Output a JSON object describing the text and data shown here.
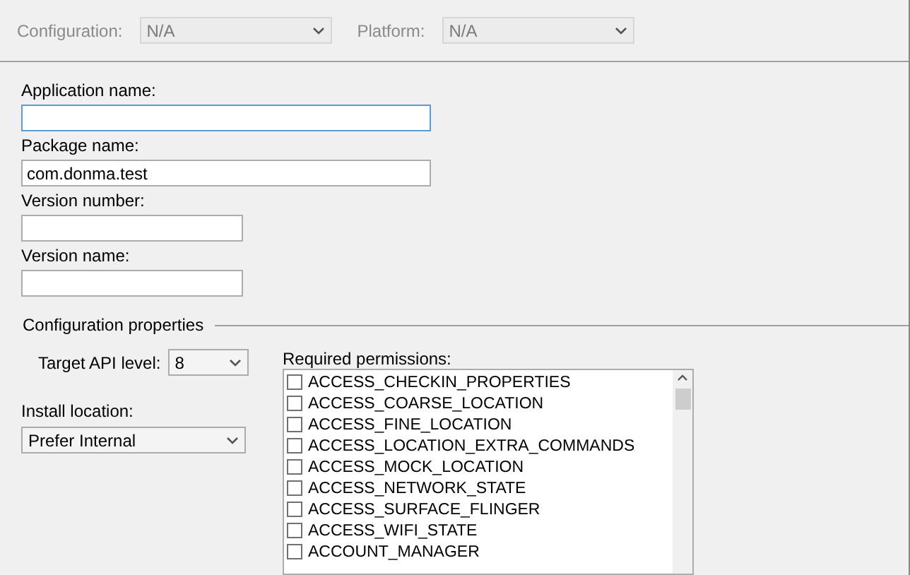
{
  "toolbar": {
    "configuration": {
      "label": "Configuration:",
      "value": "N/A",
      "disabled": true
    },
    "platform": {
      "label": "Platform:",
      "value": "N/A",
      "disabled": true
    }
  },
  "fields": [
    {
      "label": "Application name:",
      "focused": true,
      "wide": true
    },
    {
      "label": "Package name:",
      "value": "com.donma.test",
      "focused": false,
      "wide": true
    },
    {
      "label": "Version number:",
      "focused": false,
      "wide": false
    },
    {
      "label": "Version name:",
      "focused": false,
      "wide": false
    }
  ],
  "config_group": {
    "title": "Configuration properties",
    "target_api": {
      "label": "Target API level:",
      "value": "8"
    },
    "install_location": {
      "label": "Install location:",
      "value": "Prefer Internal"
    },
    "permissions": {
      "label": "Required permissions:",
      "items": [
        {
          "name": "ACCESS_CHECKIN_PROPERTIES",
          "checked": false
        },
        {
          "name": "ACCESS_COARSE_LOCATION",
          "checked": false
        },
        {
          "name": "ACCESS_FINE_LOCATION",
          "checked": false
        },
        {
          "name": "ACCESS_LOCATION_EXTRA_COMMANDS",
          "checked": false
        },
        {
          "name": "ACCESS_MOCK_LOCATION",
          "checked": false
        },
        {
          "name": "ACCESS_NETWORK_STATE",
          "checked": false
        },
        {
          "name": "ACCESS_SURFACE_FLINGER",
          "checked": false
        },
        {
          "name": "ACCESS_WIFI_STATE",
          "checked": false
        },
        {
          "name": "ACCOUNT_MANAGER",
          "checked": false
        }
      ]
    }
  }
}
